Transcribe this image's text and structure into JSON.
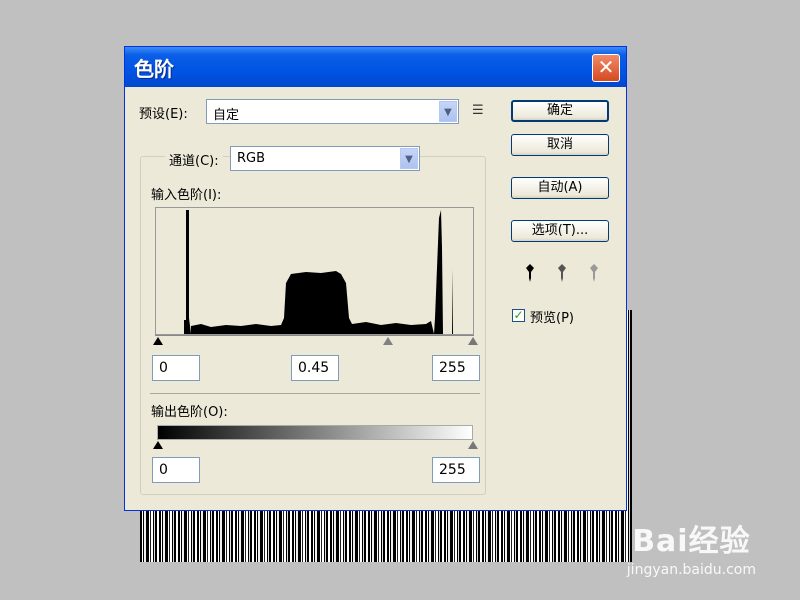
{
  "dialog": {
    "title": "色阶",
    "close_glyph": "✕"
  },
  "preset": {
    "label": "预设(E):",
    "value": "自定",
    "menu_icon": "list-menu-icon"
  },
  "channel": {
    "label": "通道(C):",
    "value": "RGB"
  },
  "input_levels": {
    "label": "输入色阶(I):",
    "black_value": "0",
    "gamma_value": "0.45",
    "white_value": "255"
  },
  "output_levels": {
    "label": "输出色阶(O):",
    "black_value": "0",
    "white_value": "255"
  },
  "buttons": {
    "ok": "确定",
    "cancel": "取消",
    "auto": "自动(A)",
    "options": "选项(T)..."
  },
  "preview": {
    "label": "预览(P)",
    "checked": true
  },
  "watermark": {
    "logo": "Bai经验",
    "url": "jingyan.baidu.com"
  },
  "colors": {
    "title_bar": "#0054e3",
    "close_button": "#d44a1f",
    "dialog_bg": "#ece9d8"
  }
}
